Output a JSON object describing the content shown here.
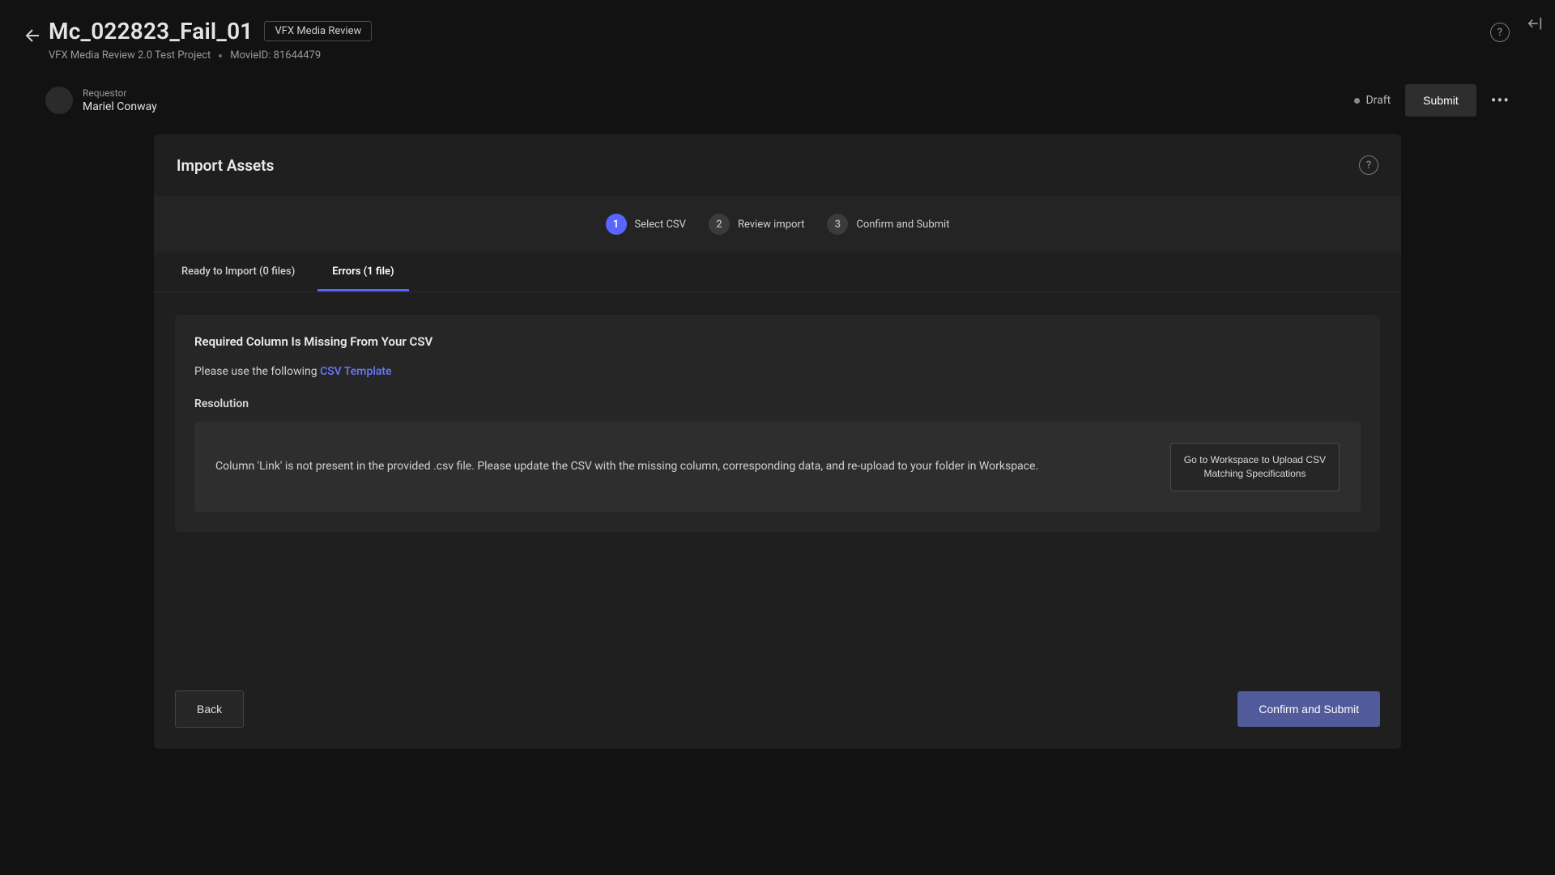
{
  "header": {
    "title": "Mc_022823_Fail_01",
    "tag": "VFX Media Review",
    "subtitle_left": "VFX Media Review 2.0 Test Project",
    "subtitle_right": "MovieID: 81644479"
  },
  "meta": {
    "requestor_label": "Requestor",
    "requestor_name": "Mariel Conway",
    "status": "Draft",
    "submit_label": "Submit"
  },
  "panel": {
    "title": "Import Assets",
    "steps": [
      {
        "num": "1",
        "label": "Select CSV"
      },
      {
        "num": "2",
        "label": "Review import"
      },
      {
        "num": "3",
        "label": "Confirm and Submit"
      }
    ],
    "tabs": {
      "ready": "Ready to Import (0 files)",
      "errors": "Errors (1 file)"
    },
    "error": {
      "title": "Required Column Is Missing From Your CSV",
      "hint_prefix": "Please use the following ",
      "hint_link": "CSV Template",
      "resolution_label": "Resolution",
      "resolution_msg": "Column 'Link' is not present in the provided .csv file. Please update the CSV with the missing column, corresponding data, and re-upload to your folder in Workspace.",
      "workspace_btn_line1": "Go to Workspace to Upload CSV",
      "workspace_btn_line2": "Matching Specifications"
    },
    "footer": {
      "back": "Back",
      "confirm": "Confirm and Submit"
    }
  },
  "icons": {
    "help_glyph": "?",
    "overflow_glyph": "•••"
  }
}
